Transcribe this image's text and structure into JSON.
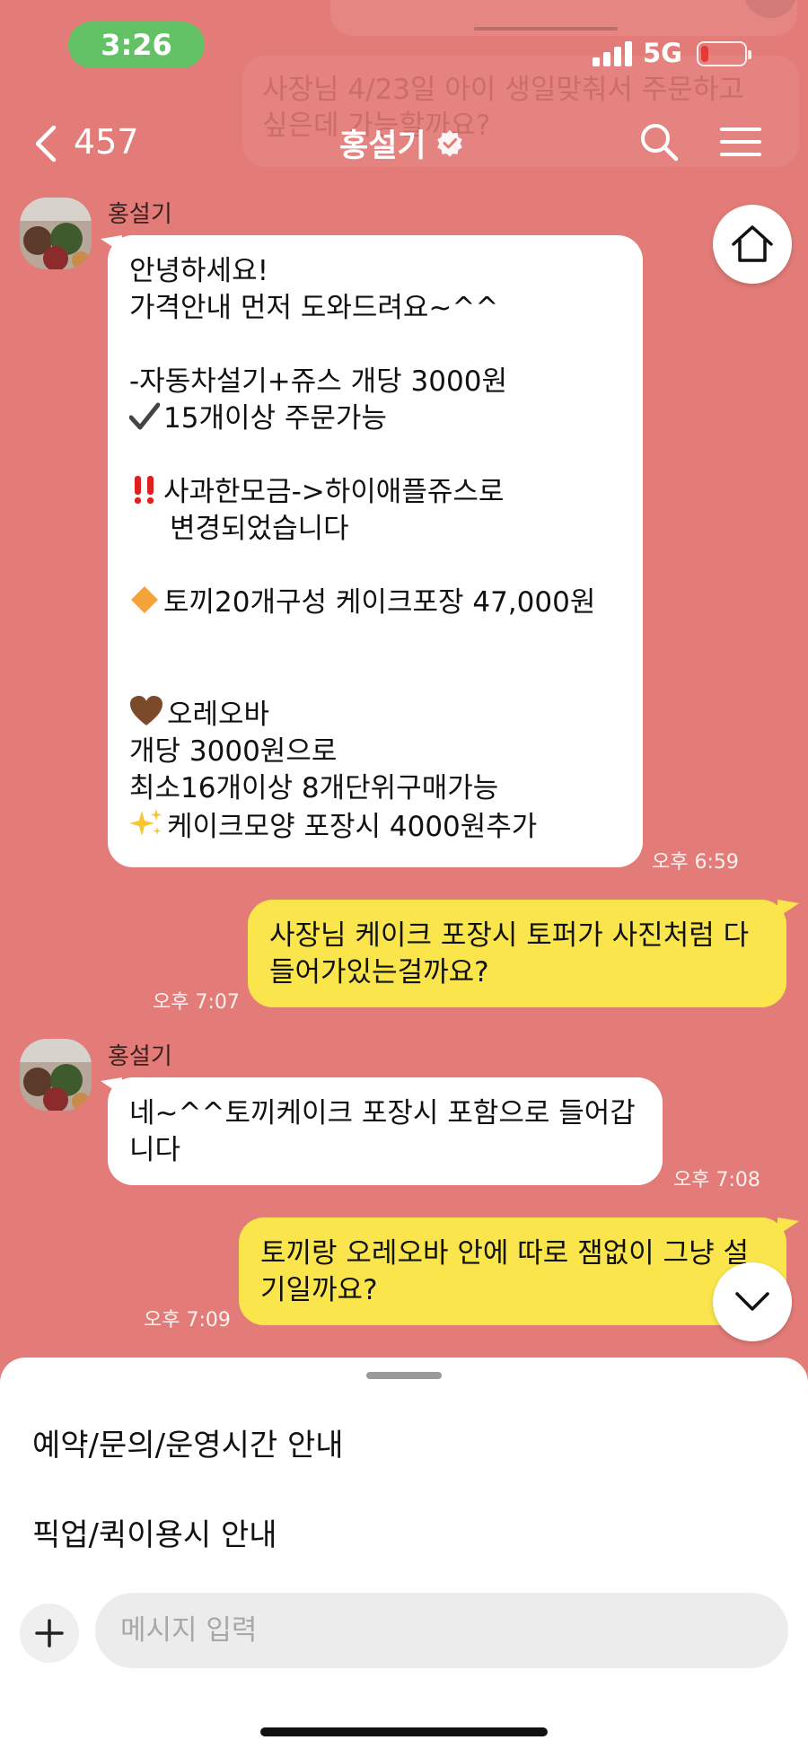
{
  "status_bar": {
    "time": "3:26",
    "network": "5G"
  },
  "ghost_banner": {
    "line1": "사장님 4/23일 아이 생일맞춰서 주문하고",
    "line2": "싶은데 가능할까요?"
  },
  "header": {
    "back_count": "457",
    "title": "홍설기"
  },
  "messages": [
    {
      "sender": "홍설기",
      "lines": [
        "안녕하세요!",
        "가격안내 먼저 도와드려요~^^",
        "",
        "-자동차설기+쥬스 개당 3000원",
        "15개이상 주문가능",
        "",
        "사과한모금->하이애플쥬스로",
        "변경되었습니다",
        "",
        "토끼20개구성 케이크포장 47,000원",
        "",
        "",
        "오레오바",
        "개당 3000원으로",
        "최소16개이상 8개단위구매가능",
        "케이크모양 포장시 4000원추가"
      ],
      "time": "오후 6:59"
    },
    {
      "lines": [
        "사장님 케이크 포장시 토퍼가 사진처럼 다",
        "들어가있는걸까요?"
      ],
      "time": "오후 7:07"
    },
    {
      "sender": "홍설기",
      "lines": [
        "네~^^토끼케이크 포장시 포함으로 들어갑",
        "니다"
      ],
      "time": "오후 7:08"
    },
    {
      "lines": [
        "토끼랑 오레오바 안에 따로 잼없이 그냥 설",
        "기일까요?"
      ],
      "time": "오후 7:09"
    }
  ],
  "icons": {
    "check": "heavy-check-mark-icon",
    "double_exclamation": "double-exclamation-icon",
    "diamond": "orange-diamond-icon",
    "heart": "brown-heart-icon",
    "sparkles": "sparkles-icon"
  },
  "quick_menu": {
    "items": [
      "예약/문의/운영시간 안내",
      "픽업/퀵이용시 안내"
    ]
  },
  "input": {
    "placeholder": "메시지 입력"
  },
  "colors": {
    "background": "#E37C78",
    "outgoing_bubble": "#FAE64C",
    "incoming_bubble": "#FFFFFF",
    "status_pill": "#63C166"
  }
}
